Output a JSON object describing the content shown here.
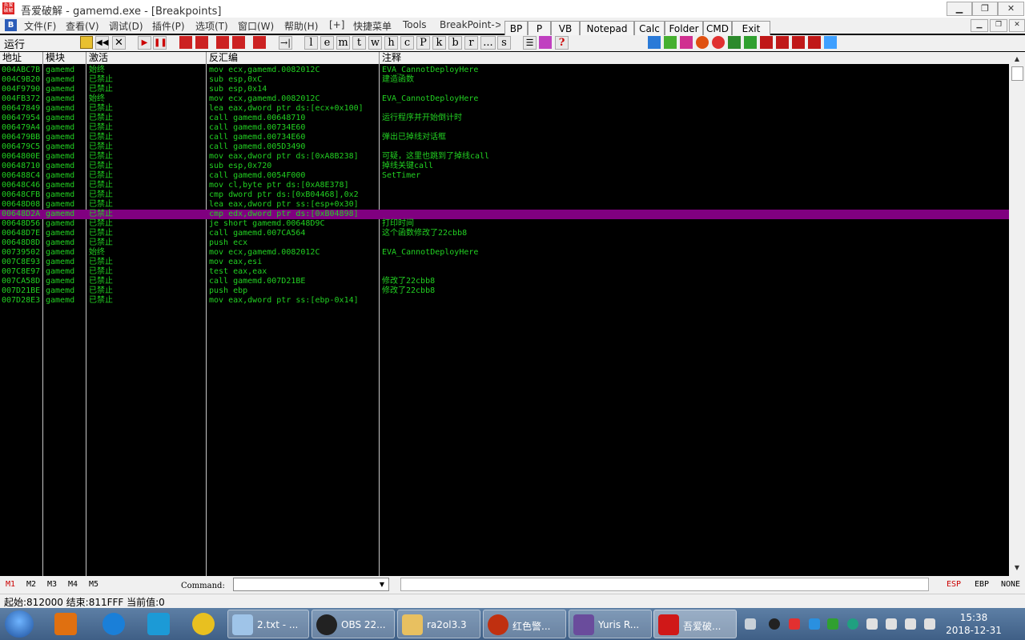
{
  "window": {
    "app_icon_text": "吾爱破解",
    "title": "吾爱破解 - gamemd.exe - [Breakpoints]",
    "buttons": {
      "minimize": "▁",
      "restore": "❐",
      "close": "✕"
    },
    "inner_buttons": {
      "minimize": "▁",
      "restore": "❐",
      "close": "✕"
    }
  },
  "menu": {
    "logo": "B",
    "items": [
      "文件(F)",
      "查看(V)",
      "调试(D)",
      "插件(P)",
      "选项(T)",
      "窗口(W)",
      "帮助(H)",
      "[+]",
      "快捷菜单",
      "Tools",
      "BreakPoint->"
    ]
  },
  "plugin_buttons": [
    "BP",
    "P",
    "VB",
    "Notepad",
    "Calc",
    "Folder",
    "CMD",
    "Exit"
  ],
  "toolbar": {
    "status": "运行",
    "letters": [
      "l",
      "e",
      "m",
      "t",
      "w",
      "h",
      "c",
      "P",
      "k",
      "b",
      "r",
      "...",
      "s"
    ],
    "help_label": "?"
  },
  "columns": [
    "地址",
    "模块",
    "激活",
    "反汇编",
    "注释"
  ],
  "rows": [
    {
      "addr": "004ABC7B",
      "module": "gamemd",
      "state": "始终",
      "disasm": "mov ecx,gamemd.0082012C",
      "comment": "EVA_CannotDeployHere"
    },
    {
      "addr": "004C9B20",
      "module": "gamemd",
      "state": "已禁止",
      "disasm": "sub esp,0xC",
      "comment": "建造函数"
    },
    {
      "addr": "004F9790",
      "module": "gamemd",
      "state": "已禁止",
      "disasm": "sub esp,0x14",
      "comment": ""
    },
    {
      "addr": "004FB372",
      "module": "gamemd",
      "state": "始终",
      "disasm": "mov ecx,gamemd.0082012C",
      "comment": "EVA_CannotDeployHere"
    },
    {
      "addr": "00647849",
      "module": "gamemd",
      "state": "已禁止",
      "disasm": "lea eax,dword ptr ds:[ecx+0x100]",
      "comment": ""
    },
    {
      "addr": "00647954",
      "module": "gamemd",
      "state": "已禁止",
      "disasm": "call gamemd.00648710",
      "comment": "运行程序并开始倒计时"
    },
    {
      "addr": "006479A4",
      "module": "gamemd",
      "state": "已禁止",
      "disasm": "call gamemd.00734E60",
      "comment": ""
    },
    {
      "addr": "006479BB",
      "module": "gamemd",
      "state": "已禁止",
      "disasm": "call gamemd.00734E60",
      "comment": "弹出已掉线对话框"
    },
    {
      "addr": "006479C5",
      "module": "gamemd",
      "state": "已禁止",
      "disasm": "call gamemd.005D3490",
      "comment": ""
    },
    {
      "addr": "0064800E",
      "module": "gamemd",
      "state": "已禁止",
      "disasm": "mov eax,dword ptr ds:[0xA8B238]",
      "comment": "可疑，这里也跳到了掉线call"
    },
    {
      "addr": "00648710",
      "module": "gamemd",
      "state": "已禁止",
      "disasm": "sub esp,0x720",
      "comment": "掉线关键call"
    },
    {
      "addr": "006488C4",
      "module": "gamemd",
      "state": "已禁止",
      "disasm": "call gamemd.0054F000",
      "comment": "SetTimer"
    },
    {
      "addr": "00648C46",
      "module": "gamemd",
      "state": "已禁止",
      "disasm": "mov cl,byte ptr ds:[0xA8E378]",
      "comment": ""
    },
    {
      "addr": "00648CFB",
      "module": "gamemd",
      "state": "已禁止",
      "disasm": "cmp dword ptr ds:[0xB04468],0x2",
      "comment": ""
    },
    {
      "addr": "00648D08",
      "module": "gamemd",
      "state": "已禁止",
      "disasm": "lea eax,dword ptr ss:[esp+0x30]",
      "comment": ""
    },
    {
      "addr": "00648D2A",
      "module": "gamemd",
      "state": "已禁止",
      "disasm": "cmp edx,dword ptr ds:[0xB04898]",
      "comment": ""
    },
    {
      "addr": "00648D56",
      "module": "gamemd",
      "state": "已禁止",
      "disasm": "je short gamemd.00648D9C",
      "comment": "打印时间"
    },
    {
      "addr": "00648D7E",
      "module": "gamemd",
      "state": "已禁止",
      "disasm": "call gamemd.007CA564",
      "comment": "这个函数修改了22cbb8"
    },
    {
      "addr": "00648D8D",
      "module": "gamemd",
      "state": "已禁止",
      "disasm": "push ecx",
      "comment": ""
    },
    {
      "addr": "00739502",
      "module": "gamemd",
      "state": "始终",
      "disasm": "mov ecx,gamemd.0082012C",
      "comment": "EVA_CannotDeployHere"
    },
    {
      "addr": "007C8E93",
      "module": "gamemd",
      "state": "已禁止",
      "disasm": "mov eax,esi",
      "comment": ""
    },
    {
      "addr": "007C8E97",
      "module": "gamemd",
      "state": "已禁止",
      "disasm": "test eax,eax",
      "comment": ""
    },
    {
      "addr": "007CA58D",
      "module": "gamemd",
      "state": "已禁止",
      "disasm": "call gamemd.007D21BE",
      "comment": "修改了22cbb8"
    },
    {
      "addr": "007D21BE",
      "module": "gamemd",
      "state": "已禁止",
      "disasm": "push ebp",
      "comment": "修改了22cbb8"
    },
    {
      "addr": "007D28E3",
      "module": "gamemd",
      "state": "已禁止",
      "disasm": "mov eax,dword ptr ss:[ebp-0x14]",
      "comment": ""
    }
  ],
  "selected_row": 15,
  "commandbar": {
    "marks": [
      "M1",
      "M2",
      "M3",
      "M4",
      "M5"
    ],
    "command_label": "Command:",
    "command_value": "",
    "dropdown_arrow": "▼",
    "registers": [
      "ESP",
      "EBP",
      "NONE"
    ]
  },
  "scrollbar": {
    "up": "▲",
    "down": "▼"
  },
  "infobar": {
    "text": "起始:812000 结束:811FFF 当前值:0"
  },
  "taskbar": {
    "tasks": [
      "2.txt - ...",
      "OBS 22...",
      "ra2ol3.3",
      "红色警...",
      "Yuris R...",
      "吾爱破..."
    ],
    "clock_time": "15:38",
    "clock_date": "2018-12-31"
  },
  "colors": {
    "row_text": "#22d022",
    "selected_row": "#800080",
    "list_bg": "#000000",
    "mark_red": "#cc0000"
  }
}
